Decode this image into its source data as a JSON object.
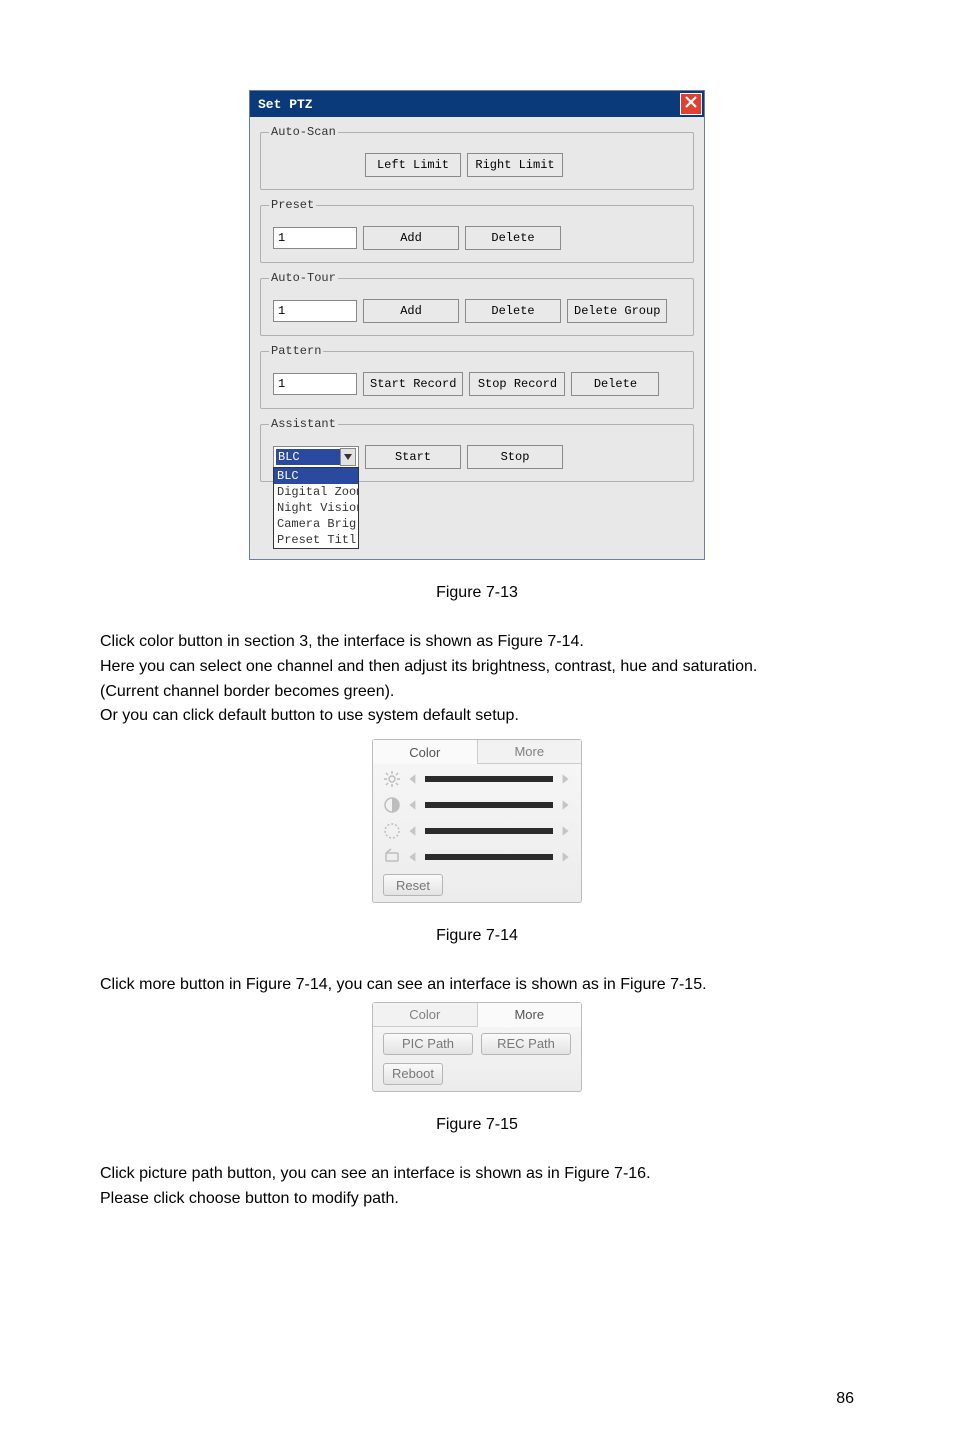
{
  "dialog": {
    "title": "Set PTZ",
    "close_icon": "close-icon",
    "groups": {
      "auto_scan": {
        "legend": "Auto-Scan",
        "left_limit": "Left Limit",
        "right_limit": "Right Limit"
      },
      "preset": {
        "legend": "Preset",
        "value": "1",
        "add": "Add",
        "delete": "Delete"
      },
      "auto_tour": {
        "legend": "Auto-Tour",
        "value": "1",
        "add": "Add",
        "delete": "Delete",
        "delete_group": "Delete Group"
      },
      "pattern": {
        "legend": "Pattern",
        "value": "1",
        "start_record": "Start Record",
        "stop_record": "Stop Record",
        "delete": "Delete"
      },
      "assistant": {
        "legend": "Assistant",
        "selected": "BLC",
        "options": [
          "BLC",
          "Digital Zoom",
          "Night Vision",
          "Camera Brig",
          "Preset Titl"
        ],
        "start": "Start",
        "stop": "Stop"
      }
    }
  },
  "captions": {
    "fig13": "Figure 7-13",
    "fig14": "Figure 7-14",
    "fig15": "Figure 7-15"
  },
  "text": {
    "p1a": "Click color button in section 3, the interface is shown as Figure 7-14.",
    "p1b": "Here you can select one channel and then adjust its brightness, contrast, hue and saturation.",
    "p1c": "(Current channel border becomes green).",
    "p1d": "Or you can click default button to use system default setup.",
    "p2": "Click more button in Figure 7-14, you can see an interface is shown as in Figure 7-15.",
    "p3a": "Click picture path button, you can see an interface is shown as in Figure 7-16.",
    "p3b": "Please click choose button to modify path."
  },
  "color_panel": {
    "tab_color": "Color",
    "tab_more": "More",
    "reset": "Reset"
  },
  "more_panel": {
    "tab_color": "Color",
    "tab_more": "More",
    "pic_path": "PIC Path",
    "rec_path": "REC Path",
    "reboot": "Reboot"
  },
  "pagenum": "86"
}
